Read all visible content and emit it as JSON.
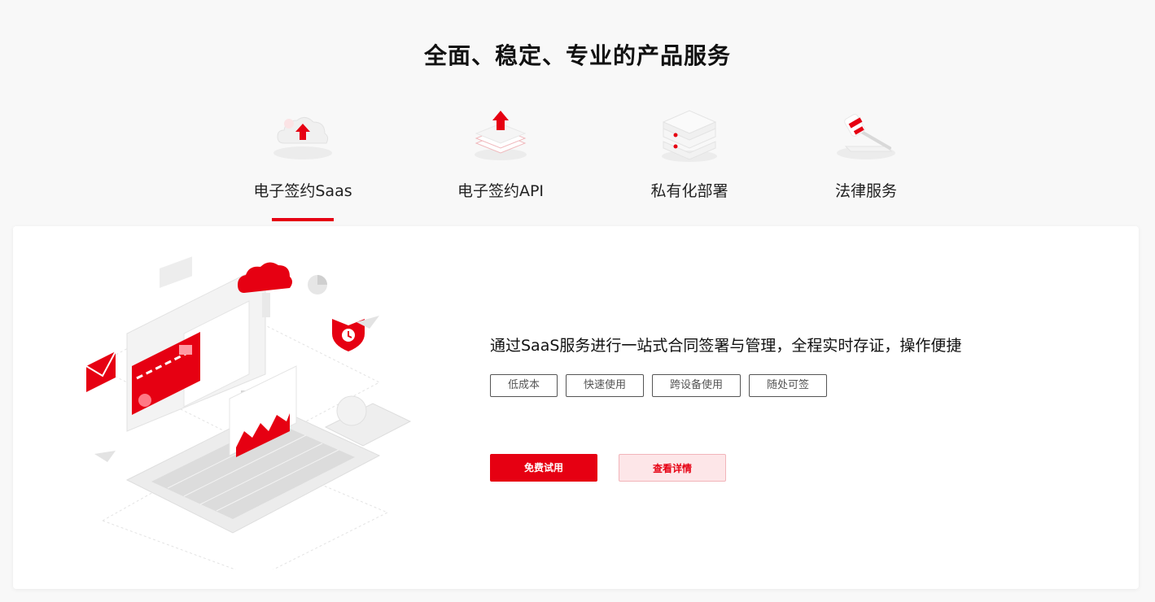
{
  "page": {
    "title": "全面、稳定、专业的产品服务"
  },
  "tabs": [
    {
      "label": "电子签约Saas",
      "icon": "cloud-upload-icon",
      "active": true
    },
    {
      "label": "电子签约API",
      "icon": "stack-upload-icon",
      "active": false
    },
    {
      "label": "私有化部署",
      "icon": "server-icon",
      "active": false
    },
    {
      "label": "法律服务",
      "icon": "gavel-icon",
      "active": false
    }
  ],
  "panel": {
    "description": "通过SaaS服务进行一站式合同签署与管理，全程实时存证，操作便捷",
    "tags": [
      "低成本",
      "快速使用",
      "跨设备使用",
      "随处可签"
    ],
    "primary_button": "免费试用",
    "secondary_button": "查看详情",
    "illustration": "saas-laptop-illustration"
  },
  "colors": {
    "accent": "#e60012",
    "accent_light": "#fde6e8",
    "background": "#f8f8f8"
  }
}
